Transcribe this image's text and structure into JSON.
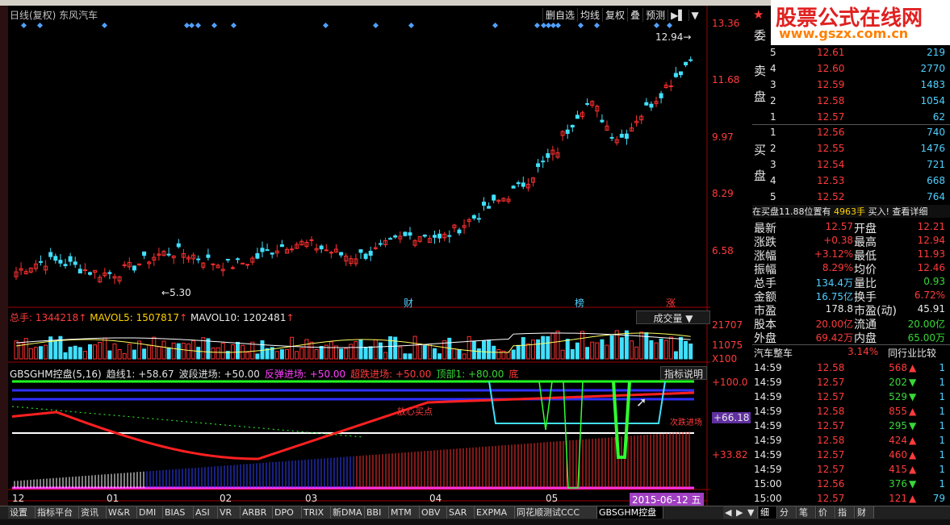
{
  "header": {
    "title": "日线(复权) 东风汽车",
    "buttons": [
      "删自选",
      "均线",
      "复权",
      "叠",
      "预测"
    ]
  },
  "price_axis": [
    "13.36",
    "11.68",
    "9.97",
    "8.29",
    "6.58"
  ],
  "annotations": {
    "high": "12.94",
    "low": "5.30",
    "marks": [
      "财",
      "榜",
      "涨"
    ]
  },
  "volume": {
    "label_total": "总手: 1344218",
    "label_ma5": "MAVOL5: 1507817",
    "label_ma10": "MAVOL10: 1202481",
    "type_select": "成交量",
    "axis": [
      "21707",
      "11075",
      "X100"
    ]
  },
  "indicator": {
    "name": "GBSGHM控盘(5,16)",
    "items": [
      {
        "text": "趋线1: +58.67",
        "color": "#e0e0e0"
      },
      {
        "text": "波段进场: +50.00",
        "color": "#e0e0e0"
      },
      {
        "text": "反弹进场: +50.00",
        "color": "#ff40ff"
      },
      {
        "text": "超跌进场: +50.00",
        "color": "#ff3b3b"
      },
      {
        "text": "顶部1: +80.00",
        "color": "#37d837"
      },
      {
        "text": "底",
        "color": "#ff3b3b"
      }
    ],
    "help_button": "指标说明",
    "axis": [
      "+100.0",
      "+66.18",
      "+33.82"
    ],
    "note": "放心买点",
    "cut_note": "次跌进场"
  },
  "date_axis": [
    "12",
    "01",
    "02",
    "03",
    "04",
    "05"
  ],
  "date_cursor": "2015-06-12 五",
  "tabs": [
    "设置",
    "指标平台",
    "资讯",
    "W&R",
    "DMI",
    "BIAS",
    "ASI",
    "VR",
    "ARBR",
    "DPO",
    "TRIX",
    "新DMA",
    "BBI",
    "MTM",
    "OBV",
    "SAR",
    "EXPMA",
    "同花顺测试CCC",
    "GBSGHM控盘"
  ],
  "right_tabs": [
    "细",
    "分",
    "笔",
    "价",
    "指",
    "财"
  ],
  "order_book": {
    "sell_label": [
      "委",
      "卖",
      "盘"
    ],
    "buy_label": [
      "买",
      "盘"
    ],
    "asks": [
      {
        "lvl": "5",
        "price": "12.61",
        "vol": "219"
      },
      {
        "lvl": "4",
        "price": "12.60",
        "vol": "2770"
      },
      {
        "lvl": "3",
        "price": "12.59",
        "vol": "1483"
      },
      {
        "lvl": "2",
        "price": "12.58",
        "vol": "1054"
      },
      {
        "lvl": "1",
        "price": "12.57",
        "vol": "62"
      }
    ],
    "bids": [
      {
        "lvl": "1",
        "price": "12.56",
        "vol": "740"
      },
      {
        "lvl": "2",
        "price": "12.55",
        "vol": "1476"
      },
      {
        "lvl": "3",
        "price": "12.54",
        "vol": "721"
      },
      {
        "lvl": "4",
        "price": "12.53",
        "vol": "668"
      },
      {
        "lvl": "5",
        "price": "12.52",
        "vol": "764"
      }
    ],
    "info_line": "在买盘11.88位置有",
    "info_vol": "4963手",
    "info_action": "买入!",
    "info_link": "查看详细"
  },
  "quotes": [
    [
      "最新",
      "12.57",
      "开盘",
      "12.21"
    ],
    [
      "涨跌",
      "+0.38",
      "最高",
      "12.94"
    ],
    [
      "涨幅",
      "+3.12%",
      "最低",
      "11.93"
    ],
    [
      "振幅",
      "8.29%",
      "均价",
      "12.46"
    ],
    [
      "总手",
      "134.4万",
      "量比",
      "0.93"
    ],
    [
      "金额",
      "16.75亿",
      "换手",
      "6.72%"
    ],
    [
      "市盈",
      "178.8",
      "市盈(动)",
      "45.91"
    ],
    [
      "股本",
      "20.00亿",
      "流通",
      "20.00亿"
    ],
    [
      "外盘",
      "69.42万",
      "内盘",
      "65.00万"
    ]
  ],
  "sector": {
    "name": "汽车整车",
    "change": "3.14%",
    "button": "同行业比较"
  },
  "ticks": [
    {
      "t": "14:59",
      "p": "12.58",
      "v": "568",
      "d": "up",
      "n": "1"
    },
    {
      "t": "14:59",
      "p": "12.57",
      "v": "202",
      "d": "down",
      "n": "1"
    },
    {
      "t": "14:59",
      "p": "12.57",
      "v": "529",
      "d": "down",
      "n": "1"
    },
    {
      "t": "14:59",
      "p": "12.58",
      "v": "855",
      "d": "up",
      "n": "1"
    },
    {
      "t": "14:59",
      "p": "12.57",
      "v": "295",
      "d": "down",
      "n": "1"
    },
    {
      "t": "14:59",
      "p": "12.58",
      "v": "424",
      "d": "up",
      "n": "1"
    },
    {
      "t": "14:59",
      "p": "12.57",
      "v": "460",
      "d": "up",
      "n": "1"
    },
    {
      "t": "14:59",
      "p": "12.57",
      "v": "415",
      "d": "up",
      "n": "1"
    },
    {
      "t": "15:00",
      "p": "12.56",
      "v": "376",
      "d": "down",
      "n": "1"
    },
    {
      "t": "15:00",
      "p": "12.57",
      "v": "121",
      "d": "up",
      "n": "79"
    }
  ],
  "ad": {
    "title": "股票公式在线网",
    "url": "www.gszx.com.cn"
  }
}
